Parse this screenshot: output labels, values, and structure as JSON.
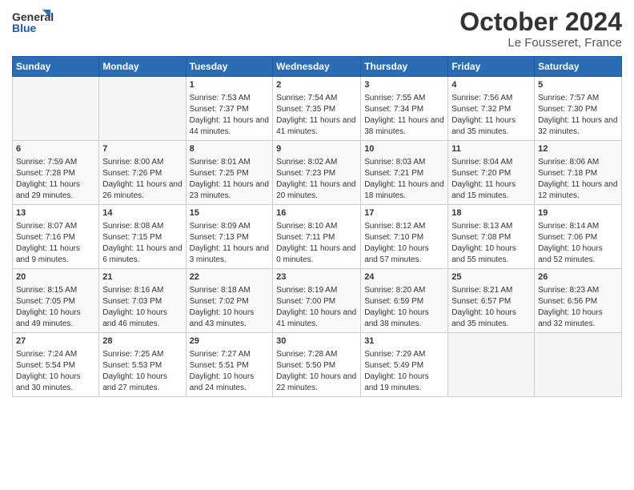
{
  "header": {
    "logo_line1": "General",
    "logo_line2": "Blue",
    "month": "October 2024",
    "location": "Le Fousseret, France"
  },
  "weekdays": [
    "Sunday",
    "Monday",
    "Tuesday",
    "Wednesday",
    "Thursday",
    "Friday",
    "Saturday"
  ],
  "weeks": [
    [
      {
        "day": "",
        "content": ""
      },
      {
        "day": "",
        "content": ""
      },
      {
        "day": "1",
        "content": "Sunrise: 7:53 AM\nSunset: 7:37 PM\nDaylight: 11 hours and 44 minutes."
      },
      {
        "day": "2",
        "content": "Sunrise: 7:54 AM\nSunset: 7:35 PM\nDaylight: 11 hours and 41 minutes."
      },
      {
        "day": "3",
        "content": "Sunrise: 7:55 AM\nSunset: 7:34 PM\nDaylight: 11 hours and 38 minutes."
      },
      {
        "day": "4",
        "content": "Sunrise: 7:56 AM\nSunset: 7:32 PM\nDaylight: 11 hours and 35 minutes."
      },
      {
        "day": "5",
        "content": "Sunrise: 7:57 AM\nSunset: 7:30 PM\nDaylight: 11 hours and 32 minutes."
      }
    ],
    [
      {
        "day": "6",
        "content": "Sunrise: 7:59 AM\nSunset: 7:28 PM\nDaylight: 11 hours and 29 minutes."
      },
      {
        "day": "7",
        "content": "Sunrise: 8:00 AM\nSunset: 7:26 PM\nDaylight: 11 hours and 26 minutes."
      },
      {
        "day": "8",
        "content": "Sunrise: 8:01 AM\nSunset: 7:25 PM\nDaylight: 11 hours and 23 minutes."
      },
      {
        "day": "9",
        "content": "Sunrise: 8:02 AM\nSunset: 7:23 PM\nDaylight: 11 hours and 20 minutes."
      },
      {
        "day": "10",
        "content": "Sunrise: 8:03 AM\nSunset: 7:21 PM\nDaylight: 11 hours and 18 minutes."
      },
      {
        "day": "11",
        "content": "Sunrise: 8:04 AM\nSunset: 7:20 PM\nDaylight: 11 hours and 15 minutes."
      },
      {
        "day": "12",
        "content": "Sunrise: 8:06 AM\nSunset: 7:18 PM\nDaylight: 11 hours and 12 minutes."
      }
    ],
    [
      {
        "day": "13",
        "content": "Sunrise: 8:07 AM\nSunset: 7:16 PM\nDaylight: 11 hours and 9 minutes."
      },
      {
        "day": "14",
        "content": "Sunrise: 8:08 AM\nSunset: 7:15 PM\nDaylight: 11 hours and 6 minutes."
      },
      {
        "day": "15",
        "content": "Sunrise: 8:09 AM\nSunset: 7:13 PM\nDaylight: 11 hours and 3 minutes."
      },
      {
        "day": "16",
        "content": "Sunrise: 8:10 AM\nSunset: 7:11 PM\nDaylight: 11 hours and 0 minutes."
      },
      {
        "day": "17",
        "content": "Sunrise: 8:12 AM\nSunset: 7:10 PM\nDaylight: 10 hours and 57 minutes."
      },
      {
        "day": "18",
        "content": "Sunrise: 8:13 AM\nSunset: 7:08 PM\nDaylight: 10 hours and 55 minutes."
      },
      {
        "day": "19",
        "content": "Sunrise: 8:14 AM\nSunset: 7:06 PM\nDaylight: 10 hours and 52 minutes."
      }
    ],
    [
      {
        "day": "20",
        "content": "Sunrise: 8:15 AM\nSunset: 7:05 PM\nDaylight: 10 hours and 49 minutes."
      },
      {
        "day": "21",
        "content": "Sunrise: 8:16 AM\nSunset: 7:03 PM\nDaylight: 10 hours and 46 minutes."
      },
      {
        "day": "22",
        "content": "Sunrise: 8:18 AM\nSunset: 7:02 PM\nDaylight: 10 hours and 43 minutes."
      },
      {
        "day": "23",
        "content": "Sunrise: 8:19 AM\nSunset: 7:00 PM\nDaylight: 10 hours and 41 minutes."
      },
      {
        "day": "24",
        "content": "Sunrise: 8:20 AM\nSunset: 6:59 PM\nDaylight: 10 hours and 38 minutes."
      },
      {
        "day": "25",
        "content": "Sunrise: 8:21 AM\nSunset: 6:57 PM\nDaylight: 10 hours and 35 minutes."
      },
      {
        "day": "26",
        "content": "Sunrise: 8:23 AM\nSunset: 6:56 PM\nDaylight: 10 hours and 32 minutes."
      }
    ],
    [
      {
        "day": "27",
        "content": "Sunrise: 7:24 AM\nSunset: 5:54 PM\nDaylight: 10 hours and 30 minutes."
      },
      {
        "day": "28",
        "content": "Sunrise: 7:25 AM\nSunset: 5:53 PM\nDaylight: 10 hours and 27 minutes."
      },
      {
        "day": "29",
        "content": "Sunrise: 7:27 AM\nSunset: 5:51 PM\nDaylight: 10 hours and 24 minutes."
      },
      {
        "day": "30",
        "content": "Sunrise: 7:28 AM\nSunset: 5:50 PM\nDaylight: 10 hours and 22 minutes."
      },
      {
        "day": "31",
        "content": "Sunrise: 7:29 AM\nSunset: 5:49 PM\nDaylight: 10 hours and 19 minutes."
      },
      {
        "day": "",
        "content": ""
      },
      {
        "day": "",
        "content": ""
      }
    ]
  ]
}
